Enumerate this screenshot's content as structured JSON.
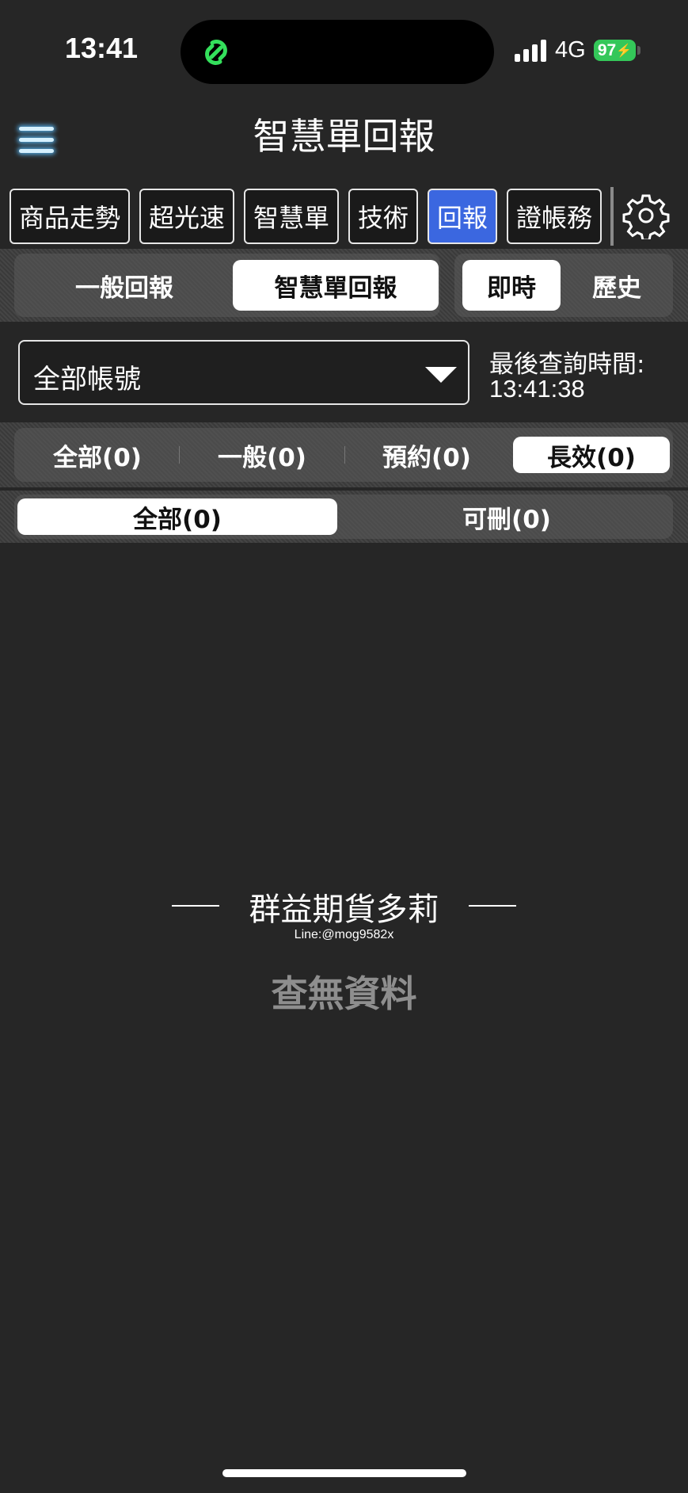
{
  "status_bar": {
    "time": "13:41",
    "network": "4G",
    "battery": "97",
    "island_icon": "link-chain-icon",
    "island_icon_color": "#34e05c",
    "battery_color": "#34c759"
  },
  "header": {
    "title": "智慧單回報",
    "menu_icon": "hamburger-menu-icon"
  },
  "top_tabs": [
    {
      "label": "商品走勢",
      "active": false
    },
    {
      "label": "超光速",
      "active": false
    },
    {
      "label": "智慧單",
      "active": false
    },
    {
      "label": "技術",
      "active": false
    },
    {
      "label": "回報",
      "active": true
    },
    {
      "label": "證帳務",
      "active": false
    }
  ],
  "settings_icon": "gear-icon",
  "report_type": {
    "options": [
      "一般回報",
      "智慧單回報"
    ],
    "selected": "智慧單回報"
  },
  "time_mode": {
    "options": [
      "即時",
      "歷史"
    ],
    "selected": "即時"
  },
  "account": {
    "selected": "全部帳號",
    "query_label": "最後查詢時間:",
    "query_time": "13:41:38"
  },
  "order_type_filter": {
    "options": [
      "全部(0)",
      "一般(0)",
      "預約(0)",
      "長效(0)"
    ],
    "selected": "長效(0)"
  },
  "delete_filter": {
    "options": [
      "全部(0)",
      "可刪(0)"
    ],
    "selected": "全部(0)"
  },
  "watermark": {
    "title": "群益期貨多莉",
    "subtitle": "Line:@mog9582x"
  },
  "empty_message": "查無資料",
  "colors": {
    "accent": "#3b67e0",
    "background": "#262626"
  }
}
